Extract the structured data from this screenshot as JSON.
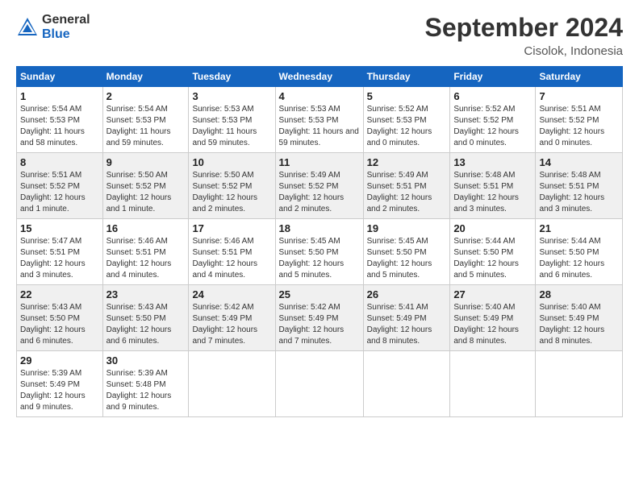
{
  "logo": {
    "general": "General",
    "blue": "Blue"
  },
  "header": {
    "month": "September 2024",
    "location": "Cisolok, Indonesia"
  },
  "days_of_week": [
    "Sunday",
    "Monday",
    "Tuesday",
    "Wednesday",
    "Thursday",
    "Friday",
    "Saturday"
  ],
  "weeks": [
    [
      {
        "day": "1",
        "sunrise": "5:54 AM",
        "sunset": "5:53 PM",
        "daylight": "11 hours and 58 minutes."
      },
      {
        "day": "2",
        "sunrise": "5:54 AM",
        "sunset": "5:53 PM",
        "daylight": "11 hours and 59 minutes."
      },
      {
        "day": "3",
        "sunrise": "5:53 AM",
        "sunset": "5:53 PM",
        "daylight": "11 hours and 59 minutes."
      },
      {
        "day": "4",
        "sunrise": "5:53 AM",
        "sunset": "5:53 PM",
        "daylight": "11 hours and 59 minutes."
      },
      {
        "day": "5",
        "sunrise": "5:52 AM",
        "sunset": "5:53 PM",
        "daylight": "12 hours and 0 minutes."
      },
      {
        "day": "6",
        "sunrise": "5:52 AM",
        "sunset": "5:52 PM",
        "daylight": "12 hours and 0 minutes."
      },
      {
        "day": "7",
        "sunrise": "5:51 AM",
        "sunset": "5:52 PM",
        "daylight": "12 hours and 0 minutes."
      }
    ],
    [
      {
        "day": "8",
        "sunrise": "5:51 AM",
        "sunset": "5:52 PM",
        "daylight": "12 hours and 1 minute."
      },
      {
        "day": "9",
        "sunrise": "5:50 AM",
        "sunset": "5:52 PM",
        "daylight": "12 hours and 1 minute."
      },
      {
        "day": "10",
        "sunrise": "5:50 AM",
        "sunset": "5:52 PM",
        "daylight": "12 hours and 2 minutes."
      },
      {
        "day": "11",
        "sunrise": "5:49 AM",
        "sunset": "5:52 PM",
        "daylight": "12 hours and 2 minutes."
      },
      {
        "day": "12",
        "sunrise": "5:49 AM",
        "sunset": "5:51 PM",
        "daylight": "12 hours and 2 minutes."
      },
      {
        "day": "13",
        "sunrise": "5:48 AM",
        "sunset": "5:51 PM",
        "daylight": "12 hours and 3 minutes."
      },
      {
        "day": "14",
        "sunrise": "5:48 AM",
        "sunset": "5:51 PM",
        "daylight": "12 hours and 3 minutes."
      }
    ],
    [
      {
        "day": "15",
        "sunrise": "5:47 AM",
        "sunset": "5:51 PM",
        "daylight": "12 hours and 3 minutes."
      },
      {
        "day": "16",
        "sunrise": "5:46 AM",
        "sunset": "5:51 PM",
        "daylight": "12 hours and 4 minutes."
      },
      {
        "day": "17",
        "sunrise": "5:46 AM",
        "sunset": "5:51 PM",
        "daylight": "12 hours and 4 minutes."
      },
      {
        "day": "18",
        "sunrise": "5:45 AM",
        "sunset": "5:50 PM",
        "daylight": "12 hours and 5 minutes."
      },
      {
        "day": "19",
        "sunrise": "5:45 AM",
        "sunset": "5:50 PM",
        "daylight": "12 hours and 5 minutes."
      },
      {
        "day": "20",
        "sunrise": "5:44 AM",
        "sunset": "5:50 PM",
        "daylight": "12 hours and 5 minutes."
      },
      {
        "day": "21",
        "sunrise": "5:44 AM",
        "sunset": "5:50 PM",
        "daylight": "12 hours and 6 minutes."
      }
    ],
    [
      {
        "day": "22",
        "sunrise": "5:43 AM",
        "sunset": "5:50 PM",
        "daylight": "12 hours and 6 minutes."
      },
      {
        "day": "23",
        "sunrise": "5:43 AM",
        "sunset": "5:50 PM",
        "daylight": "12 hours and 6 minutes."
      },
      {
        "day": "24",
        "sunrise": "5:42 AM",
        "sunset": "5:49 PM",
        "daylight": "12 hours and 7 minutes."
      },
      {
        "day": "25",
        "sunrise": "5:42 AM",
        "sunset": "5:49 PM",
        "daylight": "12 hours and 7 minutes."
      },
      {
        "day": "26",
        "sunrise": "5:41 AM",
        "sunset": "5:49 PM",
        "daylight": "12 hours and 8 minutes."
      },
      {
        "day": "27",
        "sunrise": "5:40 AM",
        "sunset": "5:49 PM",
        "daylight": "12 hours and 8 minutes."
      },
      {
        "day": "28",
        "sunrise": "5:40 AM",
        "sunset": "5:49 PM",
        "daylight": "12 hours and 8 minutes."
      }
    ],
    [
      {
        "day": "29",
        "sunrise": "5:39 AM",
        "sunset": "5:49 PM",
        "daylight": "12 hours and 9 minutes."
      },
      {
        "day": "30",
        "sunrise": "5:39 AM",
        "sunset": "5:48 PM",
        "daylight": "12 hours and 9 minutes."
      },
      null,
      null,
      null,
      null,
      null
    ]
  ]
}
